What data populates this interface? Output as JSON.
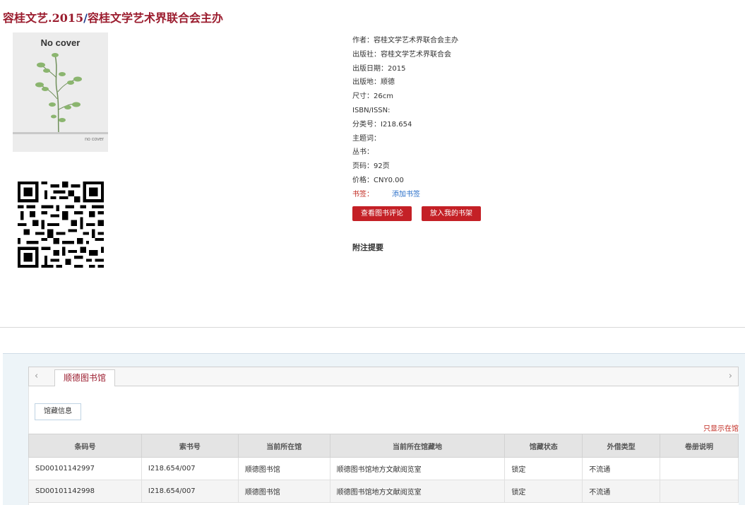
{
  "header": {
    "title_main": "容桂文艺.2015",
    "title_sep": "/",
    "title_resp": "容桂文学艺术界联合会主办"
  },
  "cover": {
    "label_top": "No cover",
    "label_bottom": "no cover"
  },
  "meta": {
    "author": "作者：容桂文学艺术界联合会主办",
    "publisher": "出版社：容桂文学艺术界联合会",
    "pub_date": "出版日期：2015",
    "pub_place": "出版地：顺德",
    "size": "尺寸：26cm",
    "isbn": "ISBN/ISSN:",
    "class_no": "分类号：I218.654",
    "subject": "主题词：",
    "series": "丛书：",
    "pages": "页码：92页",
    "price": "价格：CNY0.00",
    "tag_label": "书签：",
    "tag_add": "添加书签"
  },
  "actions": {
    "view_reviews": "查看图书评论",
    "add_shelf": "放入我的书架"
  },
  "notes_title": "附注提要",
  "holdings": {
    "nav_prev": "‹",
    "nav_next": "›",
    "library_tab": "顺德图书馆",
    "subtab": "馆藏信息",
    "only_show": "只显示在馆",
    "columns": [
      "条码号",
      "索书号",
      "当前所在馆",
      "当前所在馆藏地",
      "馆藏状态",
      "外借类型",
      "卷册说明"
    ],
    "rows": [
      [
        "SD00101142997",
        "I218.654/007",
        "顺德图书馆",
        "顺德图书馆地方文献阅览室",
        "锁定",
        "不流通",
        ""
      ],
      [
        "SD00101142998",
        "I218.654/007",
        "顺德图书馆",
        "顺德图书馆地方文献阅览室",
        "锁定",
        "不流通",
        ""
      ]
    ]
  },
  "colors": {
    "title": "#9b1c2e",
    "button": "#c42026",
    "link": "#2a6fc9"
  }
}
